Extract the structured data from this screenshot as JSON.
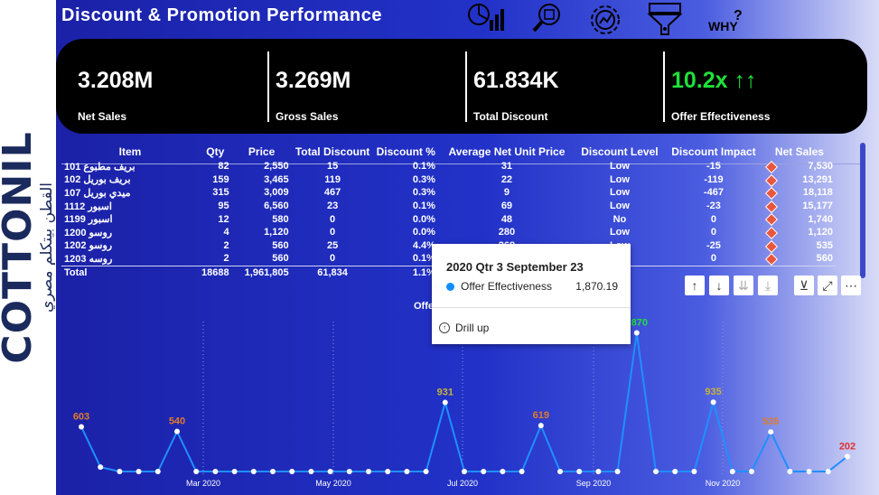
{
  "brand": {
    "name": "COTTONIL",
    "tagline": "القطن بيتكلم مصري"
  },
  "title": "Discount & Promotion Performance",
  "nav_icons": [
    "dashboard-icon",
    "search-report-icon",
    "settings-chart-icon",
    "funnel-icon",
    "why-icon"
  ],
  "why_label": "WHY",
  "kpis": [
    {
      "value": "3.208M",
      "label": "Net Sales"
    },
    {
      "value": "3.269M",
      "label": "Gross Sales"
    },
    {
      "value": "61.834K",
      "label": "Total Discount"
    },
    {
      "value": "10.2x ↑↑",
      "label": "Offer Effectiveness",
      "color": "#1fe03a"
    }
  ],
  "table": {
    "headers": [
      "Item",
      "Qty",
      "Price",
      "Total Discount",
      "Discount %",
      "Average Net Unit Price",
      "Discount Level",
      "Discount Impact",
      "Net Sales"
    ],
    "rows": [
      {
        "item": "بريف مطبوع 101",
        "qty": "82",
        "price": "2,550",
        "td": "15",
        "dp": "0.1%",
        "anu": "31",
        "dl": "Low",
        "di": "-15",
        "ns": "7,530"
      },
      {
        "item": "بريف بوريل 102",
        "qty": "159",
        "price": "3,465",
        "td": "119",
        "dp": "0.3%",
        "anu": "22",
        "dl": "Low",
        "di": "-119",
        "ns": "13,291"
      },
      {
        "item": "ميدي بوريل 107",
        "qty": "315",
        "price": "3,009",
        "td": "467",
        "dp": "0.3%",
        "anu": "9",
        "dl": "Low",
        "di": "-467",
        "ns": "18,118"
      },
      {
        "item": "اسبور 1112",
        "qty": "95",
        "price": "6,560",
        "td": "23",
        "dp": "0.1%",
        "anu": "69",
        "dl": "Low",
        "di": "-23",
        "ns": "15,177"
      },
      {
        "item": "اسبور 1199",
        "qty": "12",
        "price": "580",
        "td": "0",
        "dp": "0.0%",
        "anu": "48",
        "dl": "No",
        "di": "0",
        "ns": "1,740"
      },
      {
        "item": "روسو 1200",
        "qty": "4",
        "price": "1,120",
        "td": "0",
        "dp": "0.0%",
        "anu": "280",
        "dl": "Low",
        "di": "0",
        "ns": "1,120"
      },
      {
        "item": "روسو 1202",
        "qty": "2",
        "price": "560",
        "td": "25",
        "dp": "4.4%",
        "anu": "268",
        "dl": "Low",
        "di": "-25",
        "ns": "535"
      },
      {
        "item": "روسه 1203",
        "qty": "2",
        "price": "560",
        "td": "0",
        "dp": "0.1%",
        "anu": "280",
        "dl": "Low",
        "di": "0",
        "ns": "560"
      }
    ],
    "total": {
      "item": "Total",
      "qty": "18688",
      "price": "1,961,805",
      "td": "61,834",
      "dp": "1.1%",
      "anu": "",
      "dl": "Low",
      "di": "",
      "ns": ""
    }
  },
  "chart_data": {
    "type": "line",
    "title": "Offer Effectiveness",
    "x_ticks": [
      "Mar 2020",
      "May 2020",
      "Jul 2020",
      "Sep 2020",
      "Nov 2020"
    ],
    "series": [
      {
        "name": "Offer Effectiveness",
        "color": "#1f8fff",
        "values": [
          603,
          60,
          0,
          0,
          0,
          540,
          0,
          0,
          0,
          0,
          0,
          0,
          0,
          0,
          0,
          0,
          0,
          0,
          0,
          931,
          0,
          0,
          0,
          0,
          619,
          0,
          0,
          0,
          0,
          1870,
          0,
          0,
          0,
          935,
          0,
          0,
          535,
          0,
          0,
          0,
          202
        ]
      }
    ],
    "data_labels": [
      {
        "text": "603",
        "color": "#e07a2a"
      },
      {
        "text": "540",
        "color": "#e07a2a"
      },
      {
        "text": "931",
        "color": "#c8b23a"
      },
      {
        "text": "619",
        "color": "#e07a2a"
      },
      {
        "text": "1870",
        "color": "#1fe03a"
      },
      {
        "text": "935",
        "color": "#c8b23a"
      },
      {
        "text": "535",
        "color": "#e07a2a"
      },
      {
        "text": "202",
        "color": "#e03030"
      }
    ]
  },
  "toolbar": [
    "drill-up-icon",
    "drill-down-icon",
    "expand-level-icon",
    "expand-hierarchy-icon",
    "filter-icon",
    "focus-mode-icon",
    "more-options-icon"
  ],
  "tooltip": {
    "date": "2020 Qtr 3 September 23",
    "series": "Offer Effectiveness",
    "value": "1,870.19",
    "action": "Drill up"
  }
}
